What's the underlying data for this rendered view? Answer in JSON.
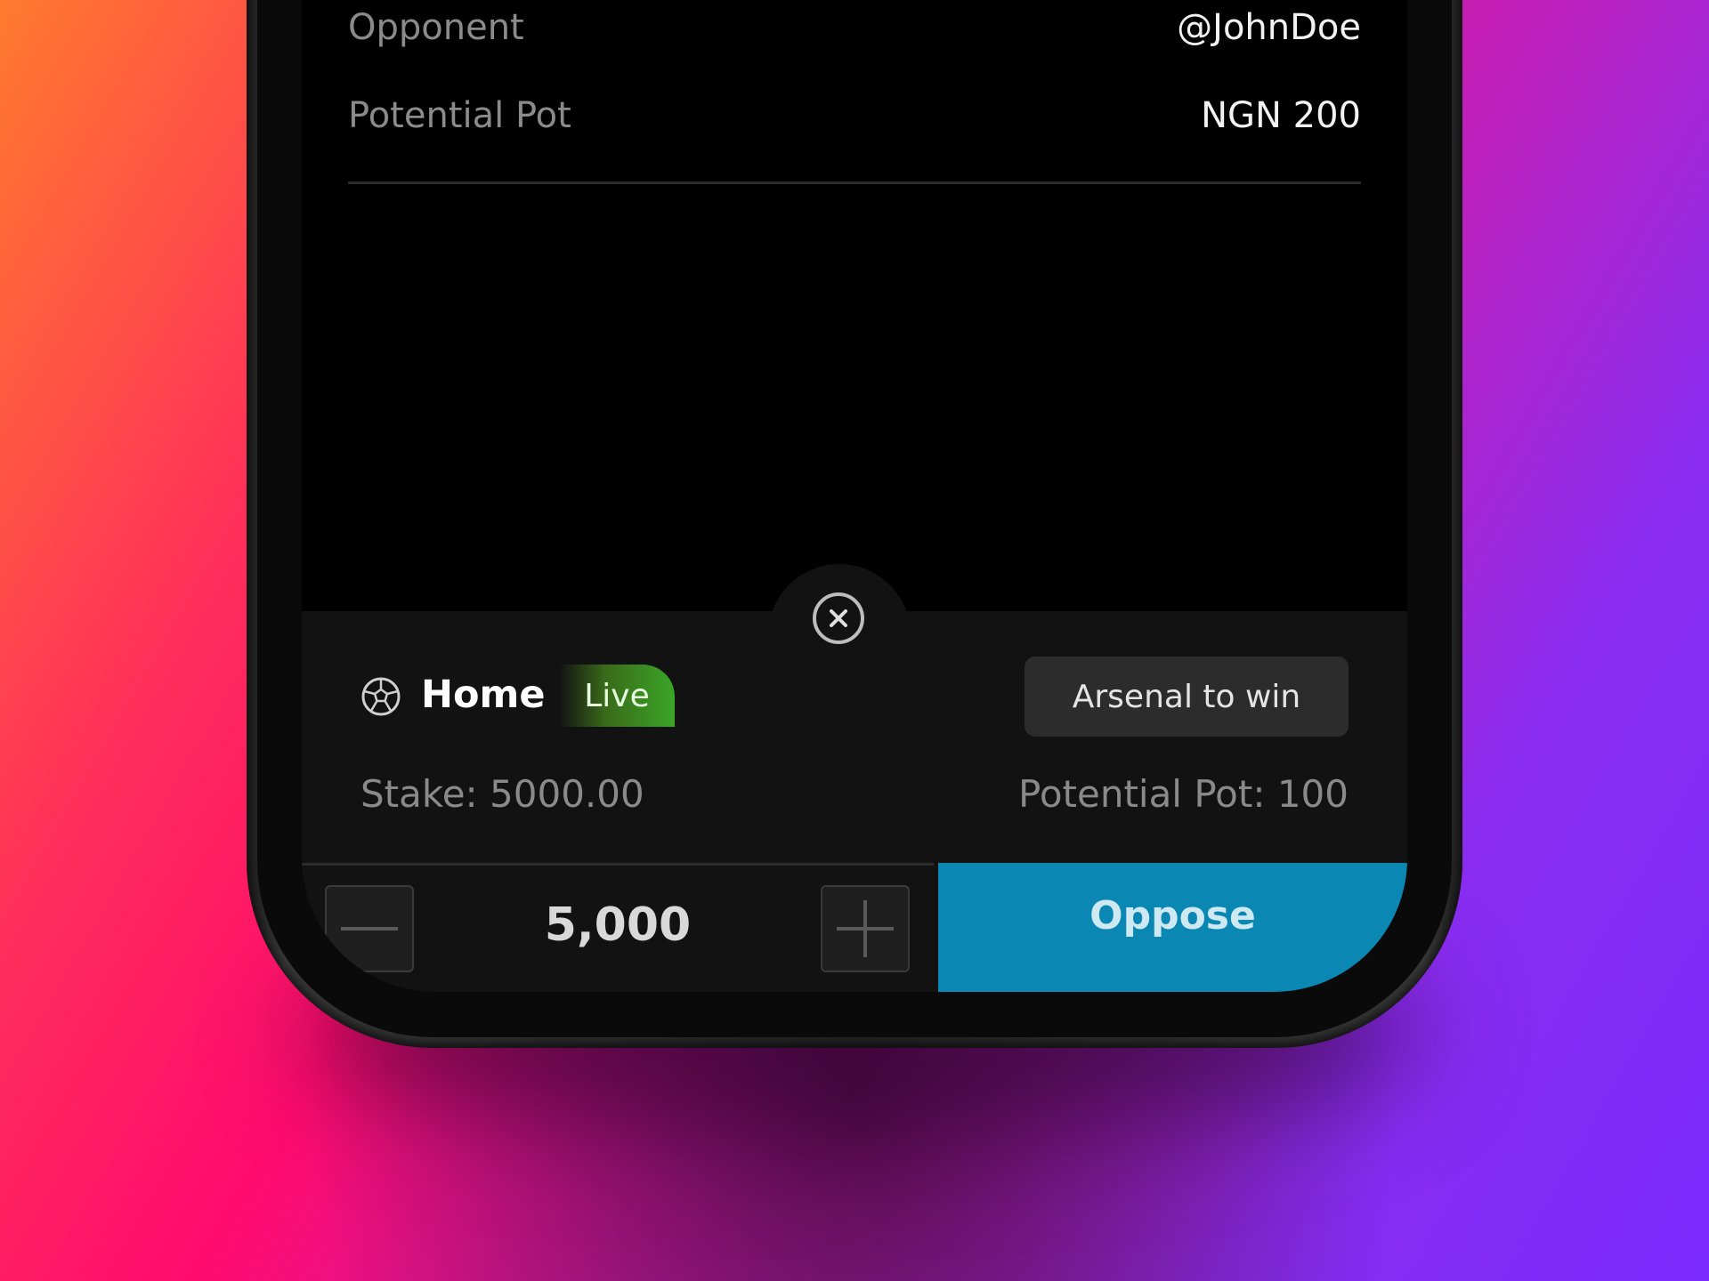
{
  "summary": {
    "opponent_label": "Opponent",
    "opponent_value": "@JohnDoe",
    "pot_label": "Potential Pot",
    "pot_value": "NGN 200"
  },
  "bet_slip": {
    "sport_icon": "soccer-ball-icon",
    "close_icon": "close-icon",
    "selection": "Home",
    "live_badge": "Live",
    "market": "Arsenal to win",
    "stake_text": "Stake: 5000.00",
    "potential_pot_text": "Potential Pot: 100",
    "amount": "5,000",
    "minus_icon": "minus-icon",
    "plus_icon": "plus-icon",
    "action_label": "Oppose"
  },
  "colors": {
    "action_button": "#0b87b4",
    "live_badge": "#3aa526",
    "sheet_background": "#121212"
  }
}
